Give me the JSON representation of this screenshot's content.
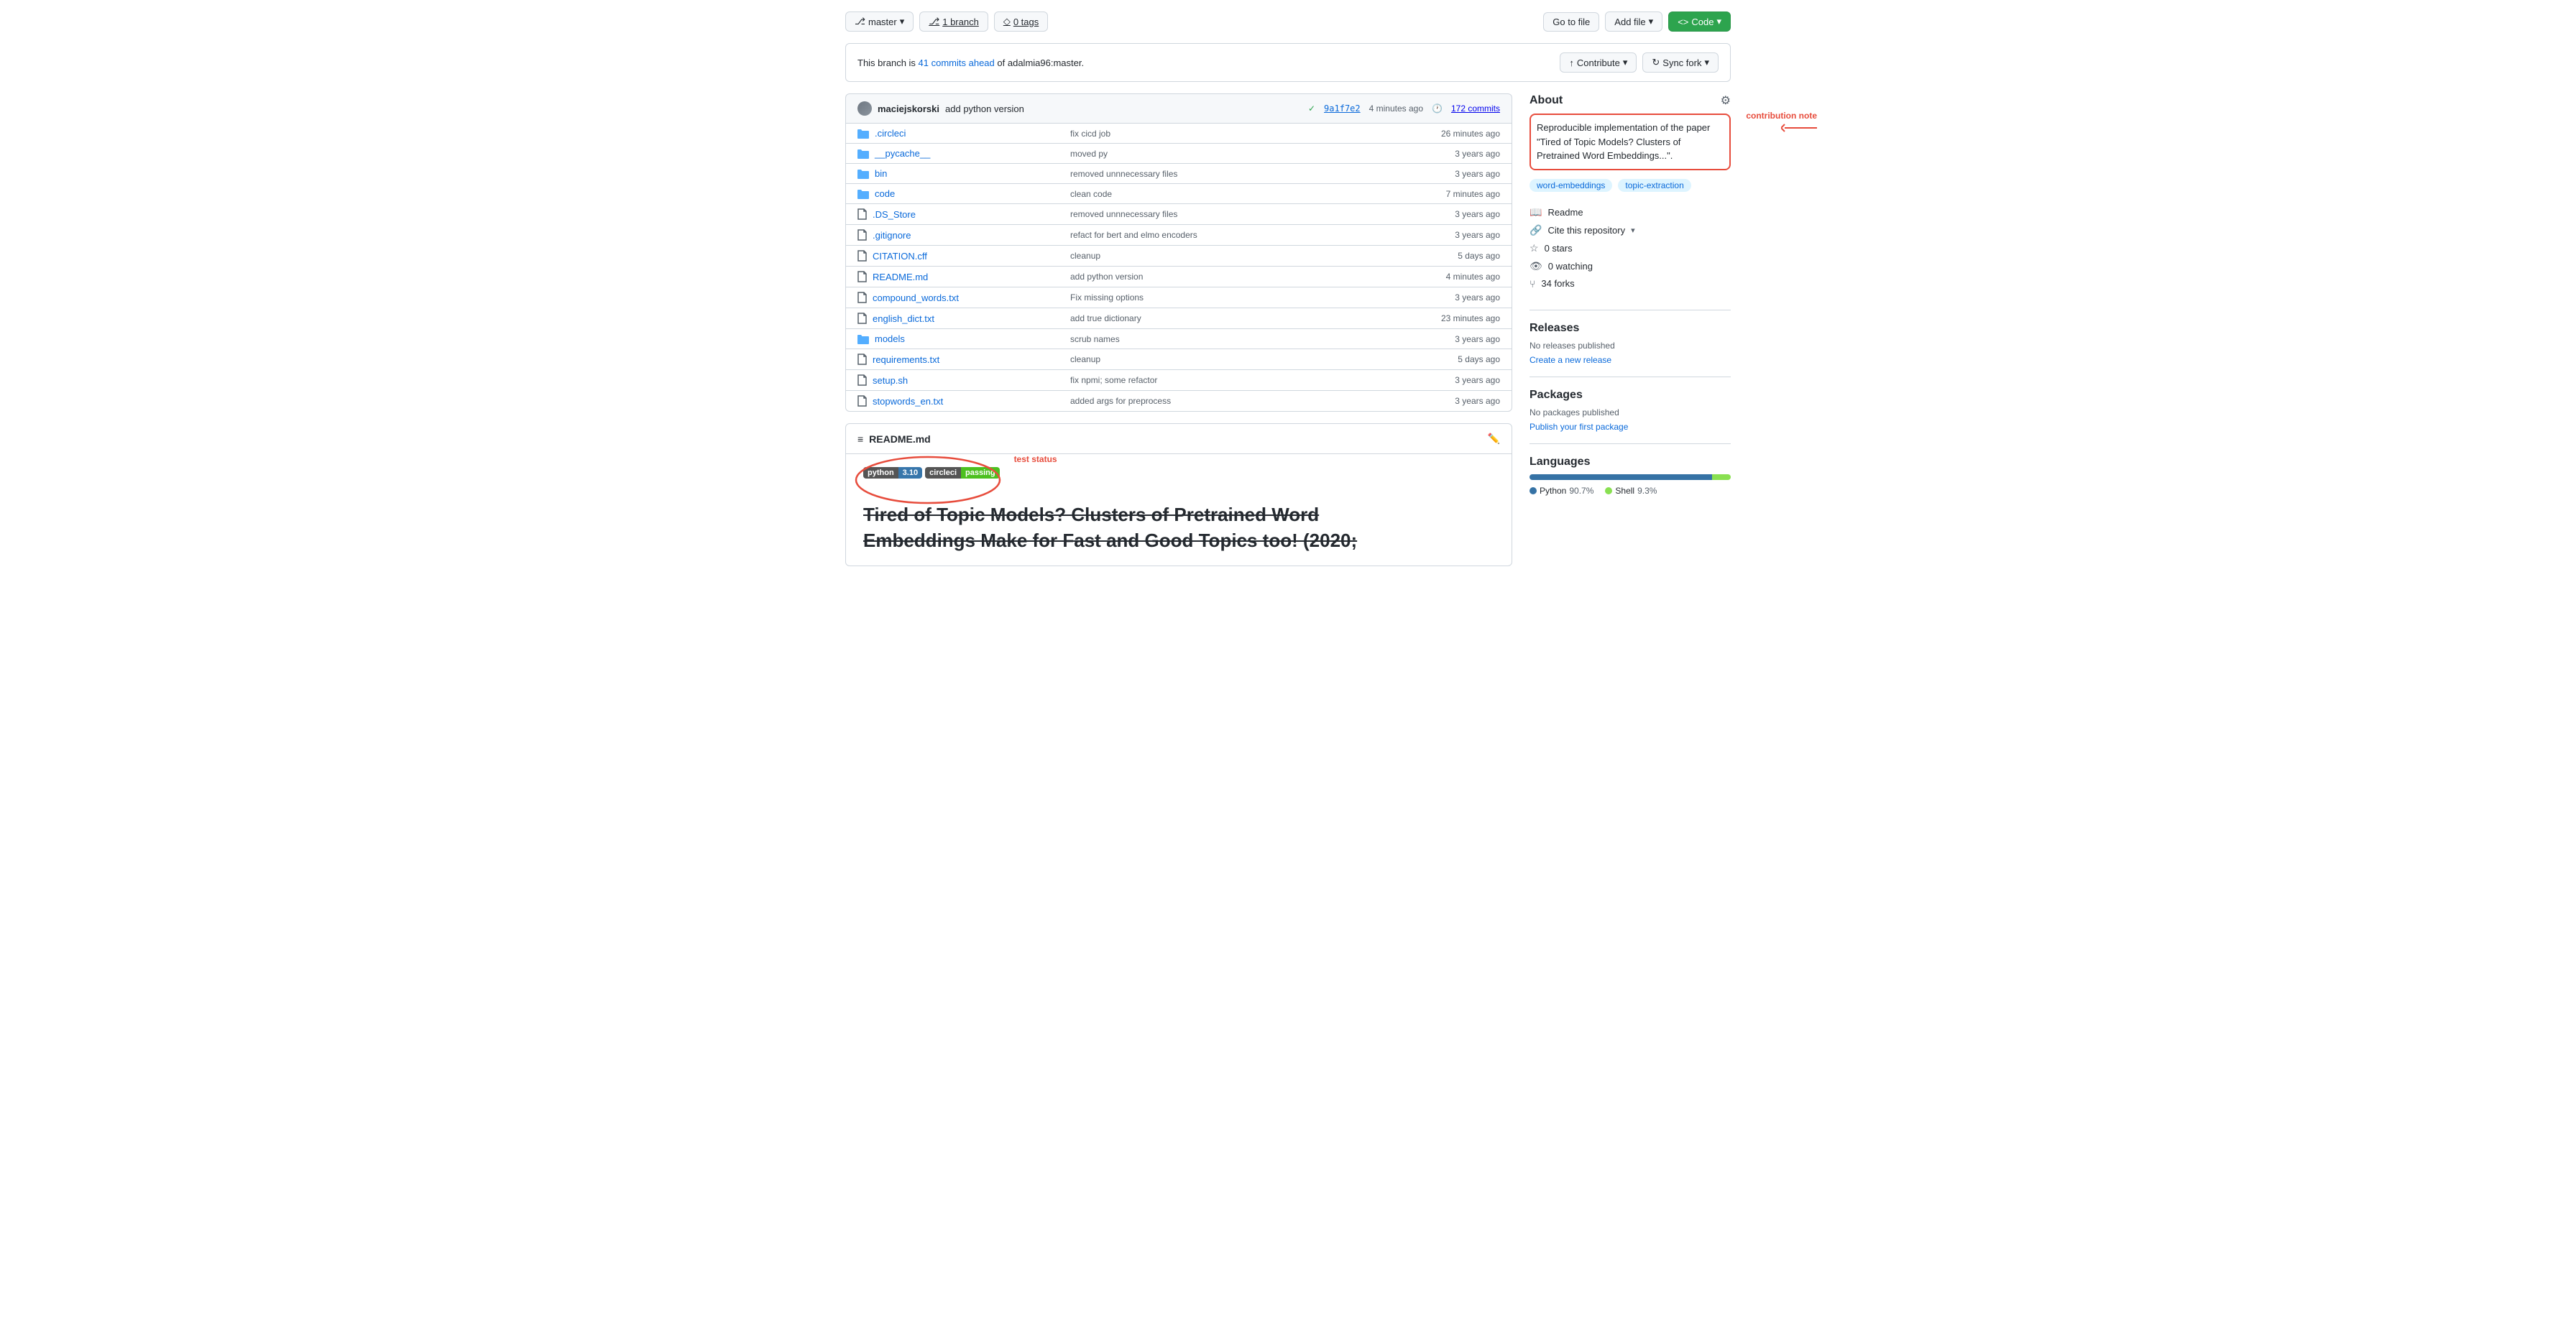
{
  "toolbar": {
    "branch_label": "master",
    "branch_icon": "⎇",
    "branch_btn": "master",
    "branches_label": "1 branch",
    "tags_label": "0 tags",
    "goto_file": "Go to file",
    "add_file": "Add file",
    "code_btn": "Code"
  },
  "branch_notice": {
    "prefix": "This branch is",
    "commits_ahead": "41 commits ahead",
    "suffix": "of adalmia96:master.",
    "contribute_label": "Contribute",
    "sync_fork_label": "Sync fork"
  },
  "commit": {
    "author": "maciejskorski",
    "message": "add python version",
    "hash": "9a1f7e2",
    "time": "4 minutes ago",
    "commits_count": "172 commits"
  },
  "files": [
    {
      "type": "folder",
      "name": ".circleci",
      "commit": "fix cicd job",
      "time": "26 minutes ago"
    },
    {
      "type": "folder",
      "name": "__pycache__",
      "commit": "moved py",
      "time": "3 years ago"
    },
    {
      "type": "folder",
      "name": "bin",
      "commit": "removed unnnecessary files",
      "time": "3 years ago"
    },
    {
      "type": "folder",
      "name": "code",
      "commit": "clean code",
      "time": "7 minutes ago"
    },
    {
      "type": "file",
      "name": ".DS_Store",
      "commit": "removed unnnecessary files",
      "time": "3 years ago"
    },
    {
      "type": "file",
      "name": ".gitignore",
      "commit": "refact for bert and elmo encoders",
      "time": "3 years ago"
    },
    {
      "type": "file",
      "name": "CITATION.cff",
      "commit": "cleanup",
      "time": "5 days ago"
    },
    {
      "type": "file",
      "name": "README.md",
      "commit": "add python version",
      "time": "4 minutes ago"
    },
    {
      "type": "file",
      "name": "compound_words.txt",
      "commit": "Fix missing options",
      "time": "3 years ago"
    },
    {
      "type": "file",
      "name": "english_dict.txt",
      "commit": "add true dictionary",
      "time": "23 minutes ago"
    },
    {
      "type": "folder",
      "name": "models",
      "commit": "scrub names",
      "time": "3 years ago"
    },
    {
      "type": "file",
      "name": "requirements.txt",
      "commit": "cleanup",
      "time": "5 days ago"
    },
    {
      "type": "file",
      "name": "setup.sh",
      "commit": "fix npmi; some refactor",
      "time": "3 years ago"
    },
    {
      "type": "file",
      "name": "stopwords_en.txt",
      "commit": "added args for preprocess",
      "time": "3 years ago"
    }
  ],
  "readme": {
    "filename": "README.md",
    "badge_python_label": "python",
    "badge_python_value": "3.10",
    "badge_circleci_label": "circleci",
    "badge_circleci_value": "passing",
    "title_line1": "Tired of Topic Models? Clusters of Pretrained Word",
    "title_line2": "Embeddings Make for Fast and Good Topics too! (2020;"
  },
  "about": {
    "title": "About",
    "description": "Reproducible implementation of the paper \"Tired of Topic Models? Clusters of Pretrained Word Embeddings...\".",
    "tags": [
      "word-embeddings",
      "topic-extraction"
    ],
    "readme_link": "Readme",
    "cite_link": "Cite this repository",
    "stars": "0 stars",
    "watching": "0 watching",
    "forks": "34 forks"
  },
  "releases": {
    "title": "Releases",
    "no_releases": "No releases published",
    "create_link": "Create a new release"
  },
  "packages": {
    "title": "Packages",
    "no_packages": "No packages published",
    "publish_link": "Publish your first package"
  },
  "languages": {
    "title": "Languages",
    "items": [
      {
        "name": "Python",
        "percent": "90.7%",
        "color": "#3572A5"
      },
      {
        "name": "Shell",
        "percent": "9.3%",
        "color": "#89e051"
      }
    ]
  },
  "annotations": {
    "contribution_note": "contribution note",
    "test_status": "test status"
  }
}
